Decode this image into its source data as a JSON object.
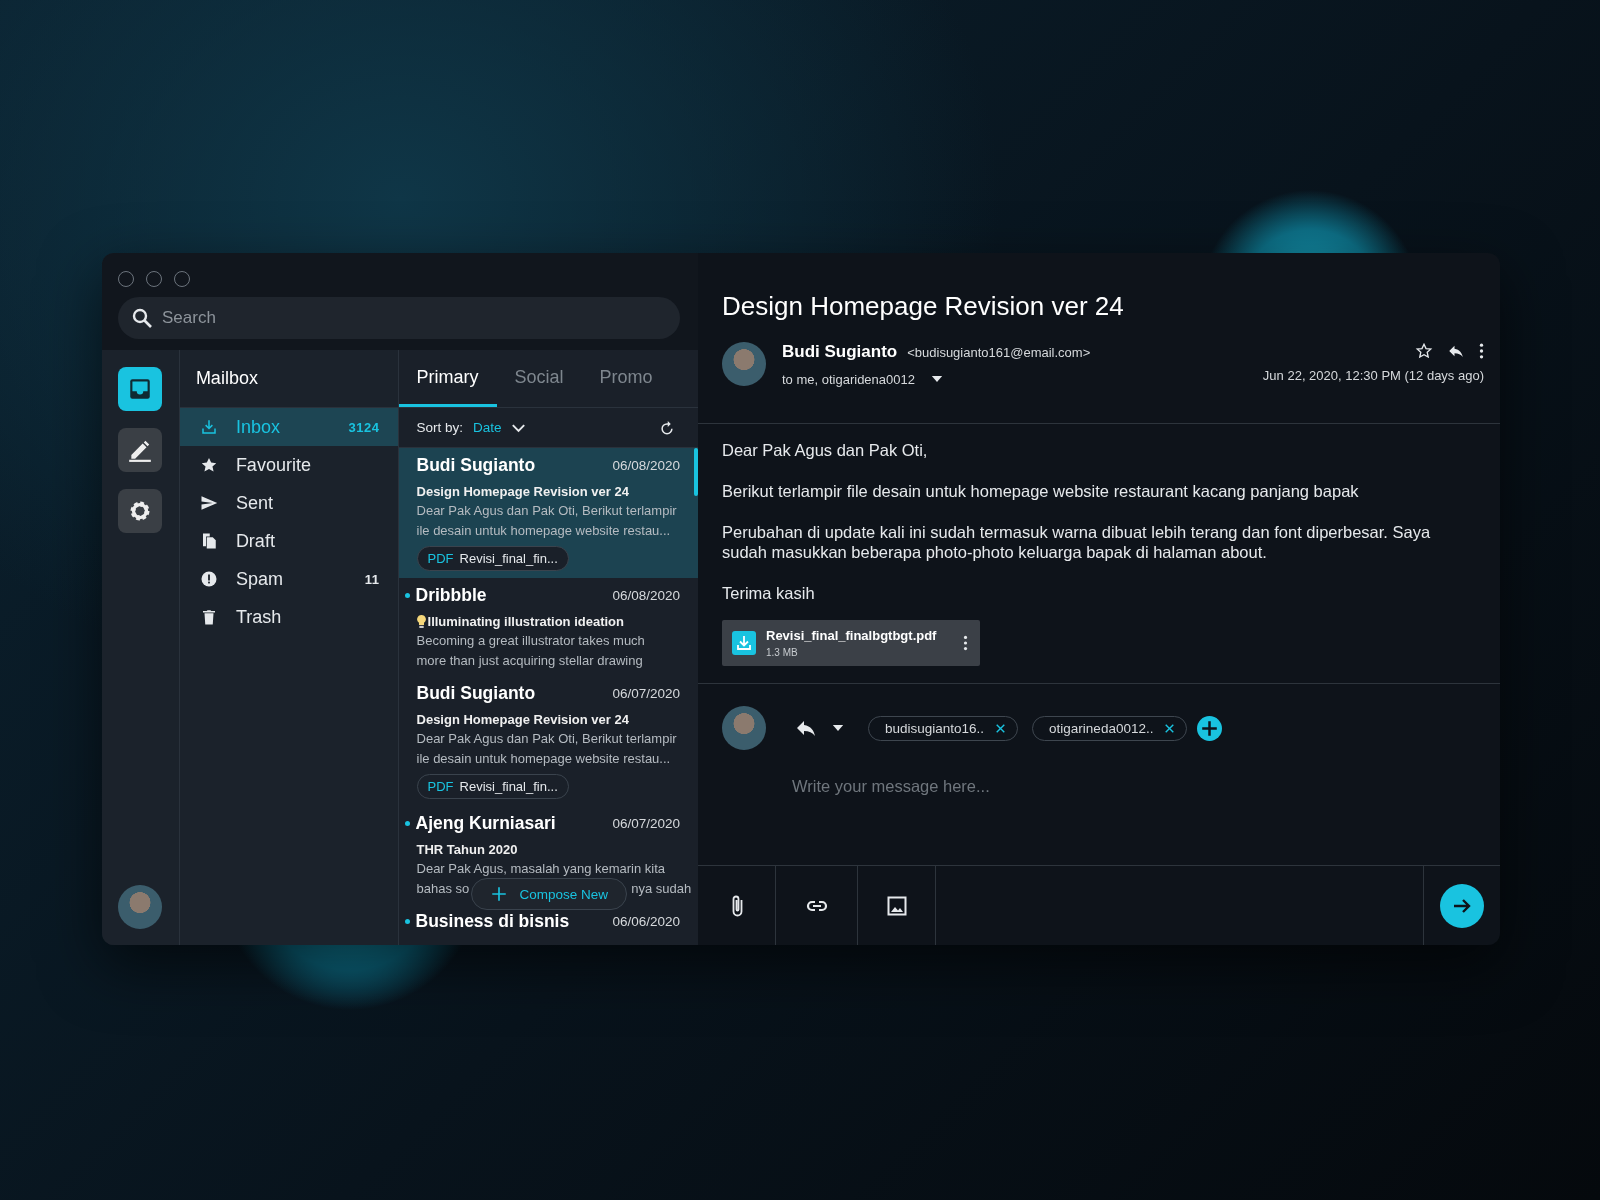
{
  "search": {
    "placeholder": "Search"
  },
  "rail": [
    {
      "kind": "inbox",
      "selected": true
    },
    {
      "kind": "compose",
      "selected": false
    },
    {
      "kind": "settings",
      "selected": false
    }
  ],
  "mailbox": {
    "title": "Mailbox",
    "folders": [
      {
        "kind": "inbox",
        "label": "Inbox",
        "count": "3124",
        "selected": true
      },
      {
        "kind": "favourite",
        "label": "Favourite",
        "selected": false
      },
      {
        "kind": "sent",
        "label": "Sent",
        "selected": false
      },
      {
        "kind": "draft",
        "label": "Draft",
        "selected": false
      },
      {
        "kind": "spam",
        "label": "Spam",
        "count": "11",
        "selected": false
      },
      {
        "kind": "trash",
        "label": "Trash",
        "selected": false
      }
    ]
  },
  "tabs": [
    {
      "label": "Primary",
      "selected": true
    },
    {
      "label": "Social",
      "selected": false
    },
    {
      "label": "Promo",
      "selected": false
    }
  ],
  "sort": {
    "label": "Sort by:",
    "value": "Date"
  },
  "messages": [
    {
      "sender": "Budi Sugianto",
      "date": "06/08/2020",
      "unread": false,
      "selected": true,
      "subject": "Design Homepage Revision ver 24",
      "preview_lines": [
        "Dear Pak Agus dan Pak Oti, Berikut terlampir",
        "ile desain untuk homepage website restau..."
      ],
      "attachment": {
        "type": "PDF",
        "name": "Revisi_final_fin..."
      }
    },
    {
      "sender": "Dribbble",
      "date": "06/08/2020",
      "unread": true,
      "selected": false,
      "bulb_icon": true,
      "subject": "Illuminating illustration ideation",
      "preview_lines": [
        "Becoming a great illustrator takes much",
        "more than just acquiring stellar drawing"
      ]
    },
    {
      "sender": "Budi Sugianto",
      "date": "06/07/2020",
      "unread": false,
      "selected": false,
      "subject": "Design Homepage Revision ver 24",
      "preview_lines": [
        "Dear Pak Agus dan Pak Oti, Berikut terlampir",
        "ile desain untuk homepage website restau..."
      ],
      "attachment": {
        "type": "PDF",
        "name": "Revisi_final_fin..."
      }
    },
    {
      "sender": "Ajeng Kurniasari",
      "date": "06/07/2020",
      "unread": true,
      "selected": false,
      "subject": "THR Tahun 2020",
      "preview_lines": [
        "Dear Pak Agus, masalah yang kemarin kita",
        "bahas so"
      ],
      "preview_after_overlay": "nya sudah"
    },
    {
      "sender": "Business di bisnis",
      "date": "06/06/2020",
      "unread": true,
      "selected": false
    }
  ],
  "compose": {
    "label": "Compose New"
  },
  "email": {
    "subject": "Design Homepage Revision ver 24",
    "sender": "Budi Sugianto",
    "address": "<budisugianto161@email.com>",
    "recipients": "to me, otigaridena0012",
    "date": "Jun 22, 2020, 12:30 PM (12 days ago)",
    "starred": false,
    "body": [
      "Dear Pak Agus dan Pak Oti,",
      "Berikut terlampir file desain untuk homepage website restaurant kacang panjang bapak",
      "Perubahan di update kali ini sudah termasuk warna dibuat lebih terang dan font diperbesar. Saya sudah masukkan beberapa photo-photo keluarga bapak di halaman about.",
      "Terima kasih"
    ],
    "attachment": {
      "name": "Revisi_final_finalbgtbgt.pdf",
      "size": "1.3 MB"
    }
  },
  "reply": {
    "recipients": [
      "budisugianto16..",
      "otigarineda0012.."
    ],
    "placeholder": "Write your message here..."
  },
  "toolbar": [
    {
      "kind": "attach"
    },
    {
      "kind": "link"
    },
    {
      "kind": "image"
    }
  ]
}
